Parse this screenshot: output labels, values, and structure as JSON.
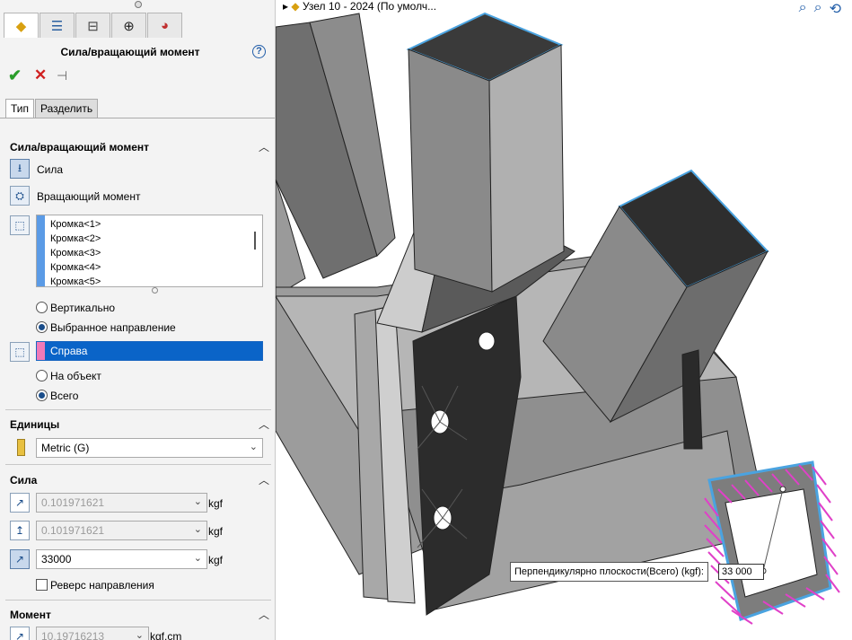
{
  "window": {
    "tree_title": "Узел 10 - 2024  (По умолч..."
  },
  "pm": {
    "title": "Сила/вращающий момент",
    "tabs": [
      "Тип",
      "Разделить"
    ],
    "section_force_torque": {
      "heading": "Сила/вращающий момент",
      "option_force": "Сила",
      "option_torque": "Вращающий момент",
      "edges": [
        "Кромка<1>",
        "Кромка<2>",
        "Кромка<3>",
        "Кромка<4>",
        "Кромка<5>"
      ],
      "radio_vertical": "Вертикально",
      "radio_selected_direction": "Выбранное направление",
      "direction_value": "Справа",
      "radio_per_item": "На объект",
      "radio_total": "Всего"
    },
    "units": {
      "heading": "Единицы",
      "value": "Metric (G)"
    },
    "force": {
      "heading": "Сила",
      "rows": [
        {
          "value": "0.101971621",
          "unit": "kgf"
        },
        {
          "value": "0.101971621",
          "unit": "kgf"
        },
        {
          "value": "33000",
          "unit": "kgf"
        }
      ],
      "reverse_label": "Реверс направления"
    },
    "moment": {
      "heading": "Момент",
      "value": "10.19716213",
      "unit": "kgf.cm"
    }
  },
  "viewport": {
    "tooltip_label": "Перпендикулярно плоскости(Всего) (kgf):",
    "tooltip_value": "33 000"
  },
  "colors": {
    "accent": "#0a64c8",
    "edge_highlight": "#4aa3e0",
    "load_arrows": "#e040c8",
    "model_gray": "#8a8a8a"
  }
}
